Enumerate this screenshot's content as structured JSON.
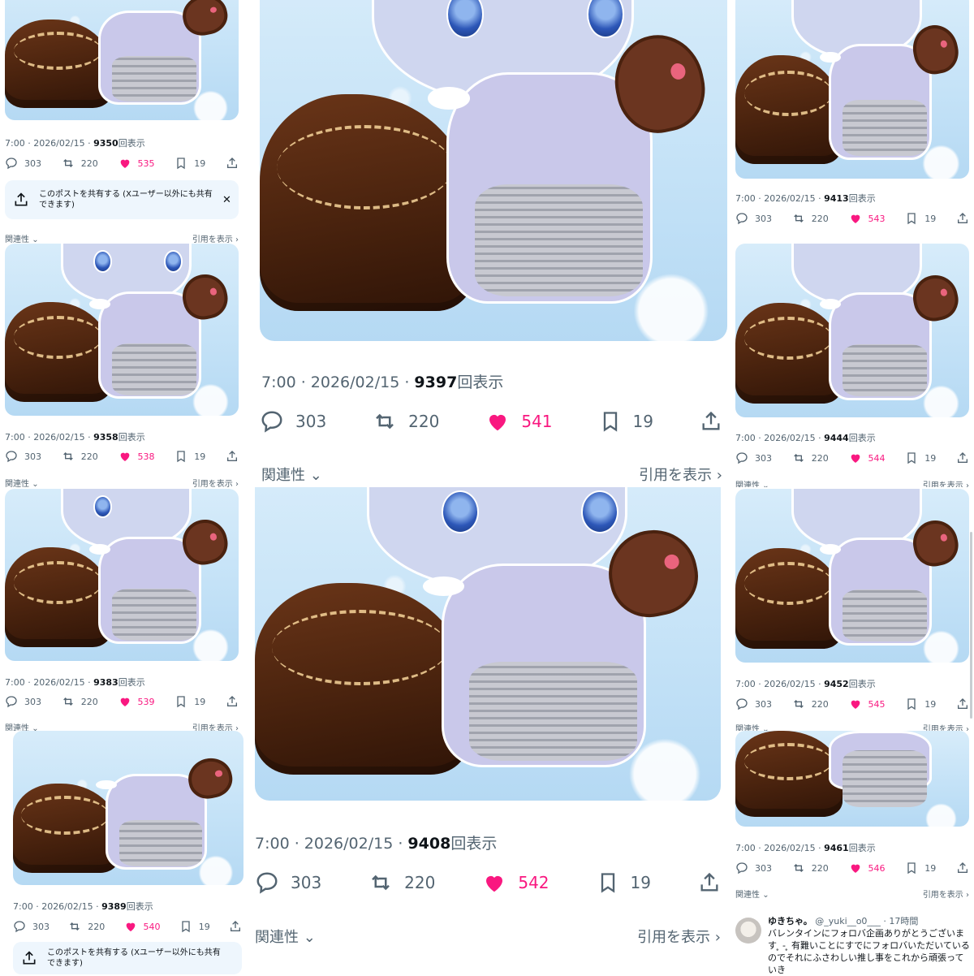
{
  "common": {
    "time_date": "7:00 · 2026/02/15 · ",
    "views_suffix": "回表示",
    "replies": "303",
    "reposts": "220",
    "bookmarks": "19",
    "relevance": "関連性",
    "quotes": "引用を表示",
    "share_prompt": "このポストを共有する (Xユーザー以外にも共有できます)",
    "like_color": "#f91880"
  },
  "posts": {
    "p1": {
      "views": "9350",
      "likes": "535"
    },
    "p2": {
      "views": "9358",
      "likes": "538"
    },
    "p3": {
      "views": "9383",
      "likes": "539"
    },
    "p4": {
      "views": "9389",
      "likes": "540"
    },
    "p5": {
      "views": "9397",
      "likes": "541"
    },
    "p6": {
      "views": "9408",
      "likes": "542"
    },
    "p7": {
      "views": "9413",
      "likes": "543"
    },
    "p8": {
      "views": "9444",
      "likes": "544"
    },
    "p9": {
      "views": "9452",
      "likes": "545"
    },
    "p10": {
      "views": "9461",
      "likes": "546"
    }
  },
  "reply": {
    "name": "ゆきちゃ。",
    "handle": "@_yuki__o0___",
    "time": "· 17時間",
    "text": "バレンタインにフォロバ企画ありがとうございます ̥ - ̥ 有難いことにすでにフォロバいただいているのでそれにふさわしい推し事をこれから頑張っていき"
  },
  "icons": [
    "reply-icon",
    "repost-icon",
    "heart-icon",
    "bookmark-icon",
    "share-icon",
    "chevron-down-icon",
    "chevron-right-icon",
    "close-icon",
    "share-external-icon"
  ]
}
